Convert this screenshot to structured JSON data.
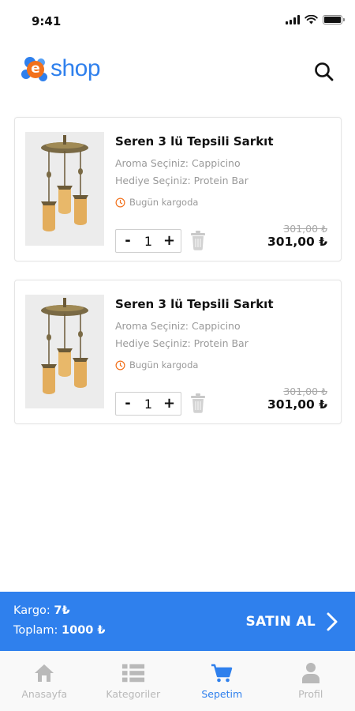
{
  "status_bar": {
    "time": "9:41"
  },
  "header": {
    "logo_text": "shop",
    "logo_mark": "e",
    "search_icon": "search-icon"
  },
  "cart": {
    "items": [
      {
        "title": "Seren 3 lü Tepsili Sarkıt",
        "option1": "Aroma Seçiniz: Cappicino",
        "option2": "Hediye Seçiniz: Protein Bar",
        "shipping": "Bugün kargoda",
        "quantity": "1",
        "minus": "-",
        "plus": "+",
        "old_price": "301,00 ₺",
        "new_price": "301,00 ₺"
      },
      {
        "title": "Seren 3 lü Tepsili Sarkıt",
        "option1": "Aroma Seçiniz: Cappicino",
        "option2": "Hediye Seçiniz: Protein Bar",
        "shipping": "Bugün kargoda",
        "quantity": "1",
        "minus": "-",
        "plus": "+",
        "old_price": "301,00 ₺",
        "new_price": "301,00 ₺"
      }
    ]
  },
  "checkout": {
    "shipping_label": "Kargo: ",
    "shipping_value": "7₺",
    "total_label": "Toplam: ",
    "total_value": "1000 ₺",
    "buy_label": "SATIN AL"
  },
  "bottom_nav": {
    "items": [
      {
        "label": "Anasayfa",
        "icon": "home-icon",
        "active": false
      },
      {
        "label": "Kategoriler",
        "icon": "list-icon",
        "active": false
      },
      {
        "label": "Sepetim",
        "icon": "cart-icon",
        "active": true
      },
      {
        "label": "Profil",
        "icon": "profile-icon",
        "active": false
      }
    ]
  },
  "colors": {
    "primary": "#2f80ed",
    "accent": "#f2711c",
    "muted": "#b9b9b9"
  }
}
